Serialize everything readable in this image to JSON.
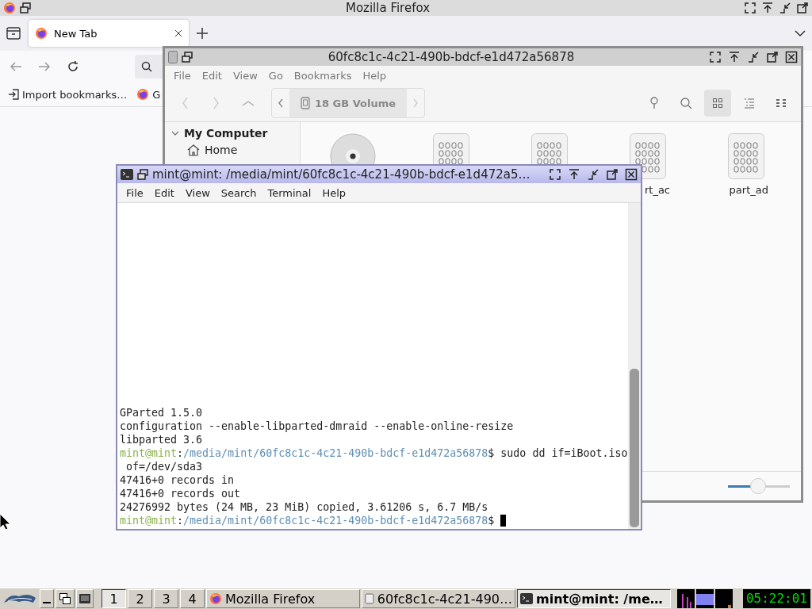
{
  "firefox": {
    "title": "Mozilla Firefox",
    "tabs": [
      {
        "label": "New Tab",
        "selected": true
      }
    ],
    "bookmarks": [
      {
        "label": "Import bookmarks…",
        "kind": "import"
      },
      {
        "label": "G",
        "kind": "site"
      }
    ]
  },
  "file_manager": {
    "title": "60fc8c1c-4c21-490b-bdcf-e1d472a56878",
    "menu": [
      "File",
      "Edit",
      "View",
      "Go",
      "Bookmarks",
      "Help"
    ],
    "location": "18 GB Volume",
    "views": [
      {
        "kind": "icons",
        "selected": true
      },
      {
        "kind": "list",
        "selected": false
      },
      {
        "kind": "compact",
        "selected": false
      }
    ],
    "sidebar": {
      "section": "My Computer",
      "expanded": true,
      "items": [
        {
          "label": "Home",
          "kind": "home"
        }
      ]
    },
    "files": [
      {
        "kind": "disc"
      },
      {
        "kind": "binary"
      },
      {
        "kind": "binary"
      },
      {
        "kind": "binary",
        "label": "rt_ac"
      },
      {
        "kind": "binary",
        "label": "part_ad"
      }
    ],
    "zoom": {
      "level": 0.49
    }
  },
  "terminal": {
    "title": "mint@mint: /media/mint/60fc8c1c-4c21-490b-bdcf-e1d472a5…",
    "menu": [
      "File",
      "Edit",
      "View",
      "Search",
      "Terminal",
      "Help"
    ],
    "lines": [
      [
        {
          "kind": "text",
          "text": "GParted 1.5.0"
        }
      ],
      [
        {
          "kind": "text",
          "text": "configuration --enable-libparted-dmraid --enable-online-resize"
        }
      ],
      [
        {
          "kind": "text",
          "text": "libparted 3.6"
        }
      ],
      [
        {
          "kind": "user",
          "text": "mint@mint"
        },
        {
          "kind": "text",
          "text": ":"
        },
        {
          "kind": "path",
          "text": "/media/mint/60fc8c1c-4c21-490b-bdcf-e1d472a56878"
        },
        {
          "kind": "text",
          "text": "$ sudo dd if=iBoot.iso"
        }
      ],
      [
        {
          "kind": "text",
          "text": " of=/dev/sda3"
        }
      ],
      [
        {
          "kind": "text",
          "text": "47416+0 records in"
        }
      ],
      [
        {
          "kind": "text",
          "text": "47416+0 records out"
        }
      ],
      [
        {
          "kind": "text",
          "text": "24276992 bytes (24 MB, 23 MiB) copied, 3.61206 s, 6.7 MB/s"
        }
      ],
      [
        {
          "kind": "user",
          "text": "mint@mint"
        },
        {
          "kind": "text",
          "text": ":"
        },
        {
          "kind": "path",
          "text": "/media/mint/60fc8c1c-4c21-490b-bdcf-e1d472a56878"
        },
        {
          "kind": "text",
          "text": "$ "
        }
      ]
    ]
  },
  "taskbar": {
    "workspaces": [
      {
        "label": "1",
        "selected": true
      },
      {
        "label": "2",
        "selected": false
      },
      {
        "label": "3",
        "selected": false
      },
      {
        "label": "4",
        "selected": false
      }
    ],
    "tasks": [
      {
        "label": "Mozilla Firefox",
        "kind": "browser",
        "selected": false
      },
      {
        "label": "60fc8c1c-4c21-490…",
        "kind": "files",
        "selected": false
      },
      {
        "label": "mint@mint: /me…",
        "kind": "terminal",
        "selected": true
      }
    ],
    "clock": "05:22:01"
  }
}
